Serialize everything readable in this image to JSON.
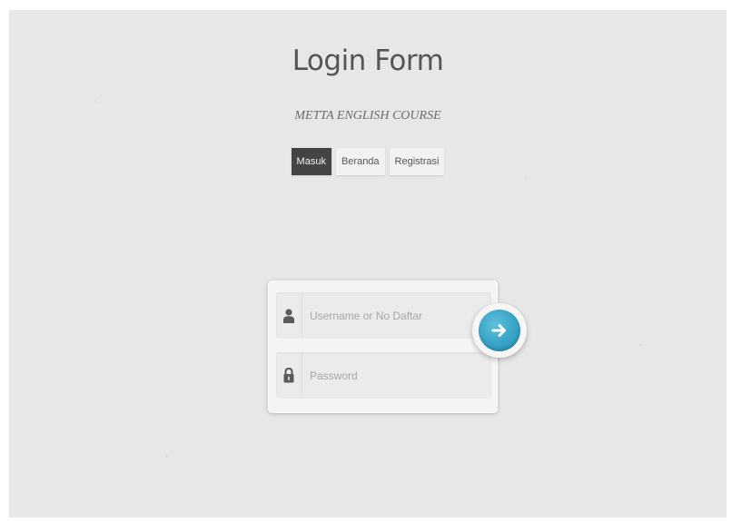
{
  "header": {
    "title": "Login Form",
    "subtitle": "METTA ENGLISH COURSE"
  },
  "nav": {
    "items": [
      {
        "label": "Masuk",
        "active": true
      },
      {
        "label": "Beranda",
        "active": false
      },
      {
        "label": "Registrasi",
        "active": false
      }
    ]
  },
  "form": {
    "username": {
      "placeholder": "Username or No Daftar",
      "value": "",
      "icon": "user-icon"
    },
    "password": {
      "placeholder": "Password",
      "value": "",
      "icon": "lock-icon"
    },
    "submit_icon": "arrow-right-icon"
  },
  "colors": {
    "background": "#e7e7e7",
    "active_nav": "#444444",
    "submit": "#2d9bc0"
  }
}
